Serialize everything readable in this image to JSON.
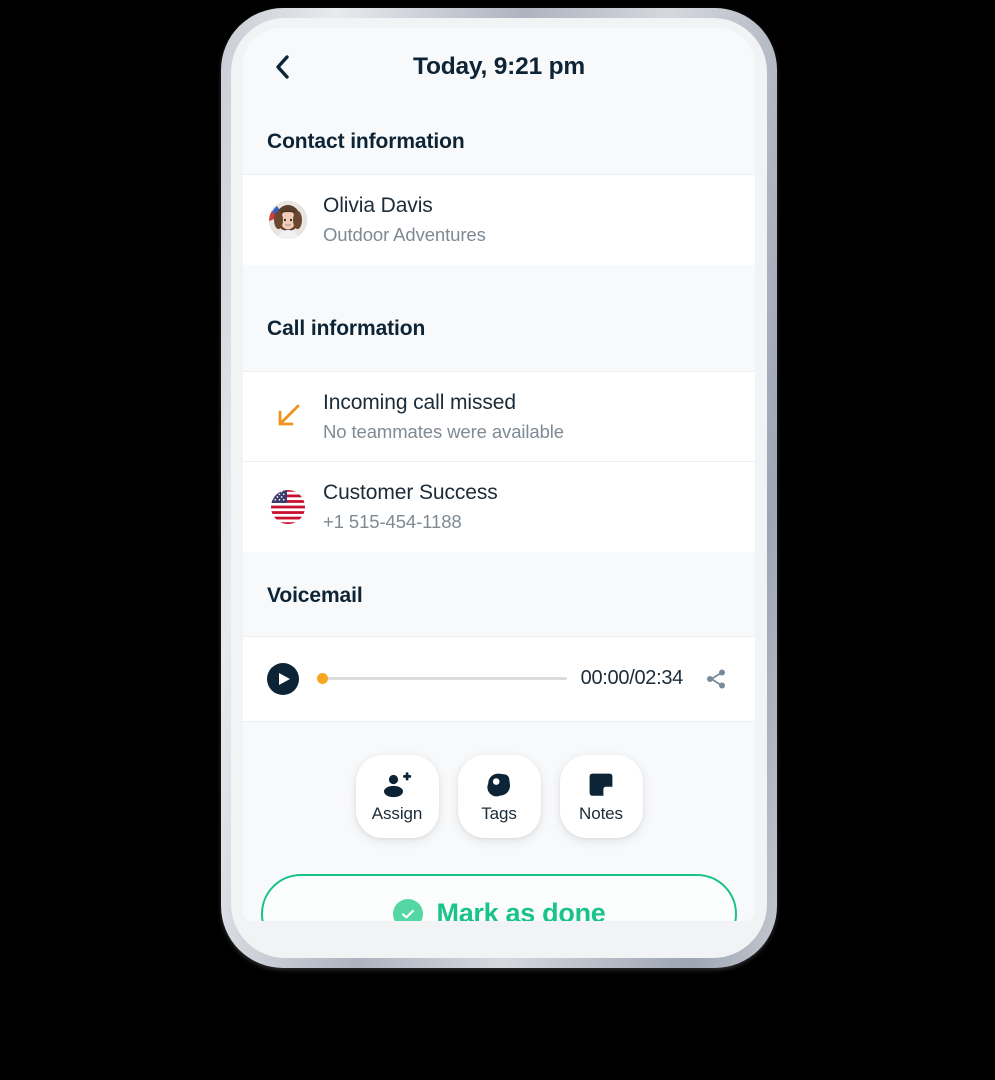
{
  "header": {
    "back_icon": "chevron-left-icon",
    "title": "Today, 9:21 pm"
  },
  "sections": {
    "contact": {
      "heading": "Contact information",
      "contact": {
        "avatar_icon": "contact-avatar-photo",
        "name": "Olivia Davis",
        "company": "Outdoor Adventures"
      }
    },
    "call": {
      "heading": "Call information",
      "status": {
        "icon": "incoming-call-missed-arrow-icon",
        "title": "Incoming call missed",
        "subtitle": "No teammates were available"
      },
      "line": {
        "icon": "us-flag-icon",
        "title": "Customer Success",
        "subtitle": "+1 515-454-1188"
      }
    },
    "voicemail": {
      "heading": "Voicemail",
      "player": {
        "play_icon": "play-icon",
        "progress_percent": 0,
        "time": "00:00/02:34",
        "share_icon": "share-icon"
      }
    }
  },
  "actions": [
    {
      "icon": "person-add-icon",
      "label": "Assign"
    },
    {
      "icon": "tag-icon",
      "label": "Tags"
    },
    {
      "icon": "note-icon",
      "label": "Notes"
    }
  ],
  "done_button": {
    "icon": "check-circle-icon",
    "label": "Mark as done"
  },
  "colors": {
    "dark": "#0d2436",
    "muted": "#7e8a94",
    "accent_orange": "#f5a623",
    "accent_green": "#19c389",
    "check_green": "#54d7a5",
    "panel": "#f8f9fa"
  }
}
